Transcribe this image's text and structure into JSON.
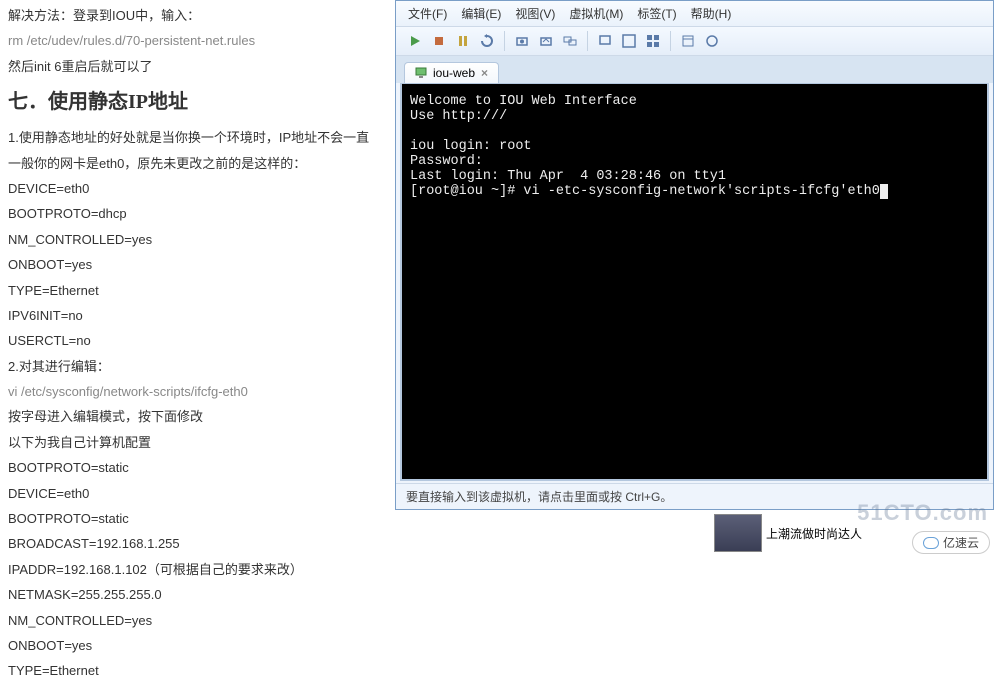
{
  "left": {
    "l1": "解决方法：登录到IOU中，输入：",
    "l2": "rm /etc/udev/rules.d/70-persistent-net.rules",
    "l3": "然后init 6重启后就可以了",
    "h7": "七．使用静态IP地址",
    "l4": "1.使用静态地址的好处就是当你换一个环境时，IP地址不会一直",
    "l5": "一般你的网卡是eth0，原先未更改之前的是这样的：",
    "l6": "DEVICE=eth0",
    "l7": "BOOTPROTO=dhcp",
    "l8": "NM_CONTROLLED=yes",
    "l9": "ONBOOT=yes",
    "l10": "TYPE=Ethernet",
    "l11": "IPV6INIT=no",
    "l12": "USERCTL=no",
    "l13": "2.对其进行编辑：",
    "l14": "vi /etc/sysconfig/network-scripts/ifcfg-eth0",
    "l15": "按字母进入编辑模式，按下面修改",
    "l16": "以下为我自己计算机配置",
    "l17": "BOOTPROTO=static",
    "l18": "DEVICE=eth0",
    "l19": "BOOTPROTO=static",
    "l20": "BROADCAST=192.168.1.255",
    "l21": "IPADDR=192.168.1.102（可根据自己的要求来改）",
    "l22": "NETMASK=255.255.255.0",
    "l23": "NM_CONTROLLED=yes",
    "l24": "ONBOOT=yes",
    "l25": "TYPE=Ethernet"
  },
  "menu": {
    "file": "文件(F)",
    "edit": "编辑(E)",
    "view": "视图(V)",
    "vm": "虚拟机(M)",
    "tabs": "标签(T)",
    "help": "帮助(H)"
  },
  "tab": {
    "label": "iou-web"
  },
  "term": {
    "t1": "Welcome to IOU Web Interface",
    "t2": "Use http:///",
    "t3": "iou login: root",
    "t4": "Password:",
    "t5": "Last login: Thu Apr  4 03:28:46 on tty1",
    "t6": "[root@iou ~]# vi -etc-sysconfig-network'scripts-ifcfg'eth0"
  },
  "status": "要直接输入到该虚拟机，请点击里面或按 Ctrl+G。",
  "bottom": {
    "caption": "上潮流做时尚达人"
  },
  "watermark": "51CTO.com",
  "yun": "亿速云"
}
